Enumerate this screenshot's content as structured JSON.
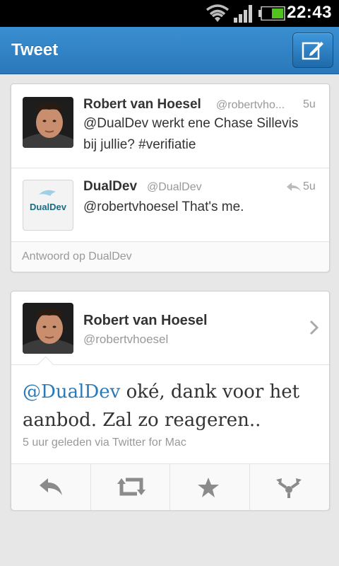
{
  "status_bar": {
    "time": "22:43"
  },
  "action_bar": {
    "title": "Tweet"
  },
  "conversation": {
    "tweets": [
      {
        "name": "Robert van Hoesel",
        "handle": "@robertvho...",
        "age": "5u",
        "text_line1": "@DualDev werkt ene Chase Sillevis",
        "text_line2": "bij jullie? #verifiatie"
      },
      {
        "name": "DualDev",
        "handle": "@DualDev",
        "age": "5u",
        "text": "@robertvhoesel That's me.",
        "avatar_logo": "DualDev"
      }
    ],
    "reply_label": "Antwoord op DualDev"
  },
  "detail": {
    "name": "Robert van Hoesel",
    "handle": "@robertvhoesel",
    "mention": "@DualDev",
    "text_rest": " oké, dank voor het aanbod. Zal zo reageren..",
    "meta": "5 uur geleden via Twitter for Mac",
    "actions": [
      "reply-icon",
      "retweet-icon",
      "favorite-icon",
      "share-icon"
    ]
  },
  "colors": {
    "accent": "#2a7ab9",
    "actionbar": "#3a8fd0",
    "text": "#333333",
    "muted": "#999999"
  }
}
